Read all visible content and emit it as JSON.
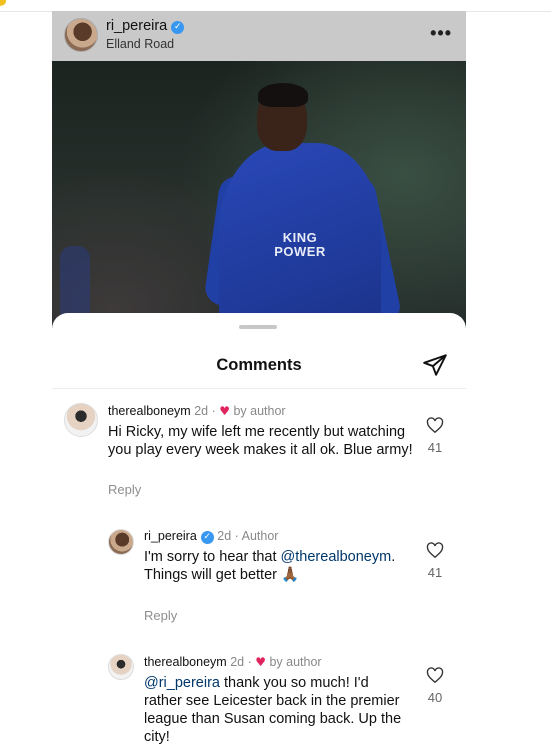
{
  "post": {
    "username": "ri_pereira",
    "location": "Elland Road",
    "more_label": "•••",
    "sponsor_line1": "KING",
    "sponsor_line2": "POWER"
  },
  "sheet": {
    "title": "Comments"
  },
  "comments": [
    {
      "username": "therealboneym",
      "time": "2d",
      "badge": "by author",
      "text": "Hi Ricky, my wife left me recently but watching you play every week makes it all ok. Blue army!",
      "reply_label": "Reply",
      "likes": "41"
    },
    {
      "username": "ri_pereira",
      "time": "2d",
      "badge": "Author",
      "mention": "@therealboneym",
      "text_before": "I'm sorry to hear that ",
      "text_after": ". Things will get better",
      "emoji": "🙏🏾",
      "reply_label": "Reply",
      "likes": "41"
    },
    {
      "username": "therealboneym",
      "time": "2d",
      "badge": "by author",
      "mention": "@ri_pereira",
      "text_after": " thank you so much! I'd rather see Leicester back in the premier league than Susan coming back. Up the city!",
      "likes": "40"
    }
  ],
  "icons": {
    "verified": "verified-badge-icon",
    "send": "paper-plane-icon",
    "like": "heart-outline-icon",
    "liked_by_author": "heart-filled-icon"
  },
  "colors": {
    "verified": "#3897f0",
    "heart": "#e0245e",
    "mention": "#00376b"
  }
}
